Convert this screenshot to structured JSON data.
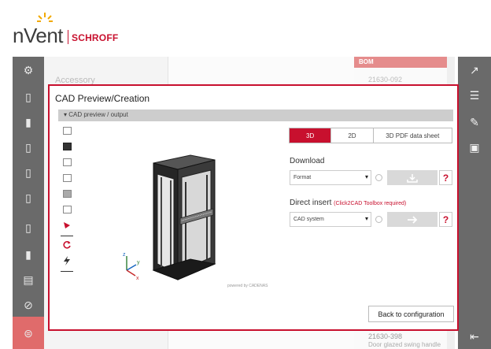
{
  "brand": {
    "name": "nVent",
    "product": "SCHROFF"
  },
  "background": {
    "accessory_label": "Accessory",
    "bom_header": "BOM",
    "bom_part_top": "21630-092",
    "bom_part_bottom": "21630-398",
    "bom_part_bottom_desc": "Door glazed swing handle"
  },
  "modal": {
    "title": "CAD Preview/Creation",
    "section": "▾ CAD preview / output",
    "powered_by": "powered by CADENAS",
    "tabs": [
      {
        "label": "3D",
        "active": true
      },
      {
        "label": "2D",
        "active": false
      },
      {
        "label": "3D PDF data sheet",
        "active": false
      }
    ],
    "download": {
      "heading": "Download",
      "select_value": "Format",
      "help": "?"
    },
    "direct_insert": {
      "heading": "Direct insert",
      "note": "(Click2CAD Toolbox required)",
      "select_value": "CAD system",
      "help": "?"
    },
    "back_button": "Back to configuration"
  },
  "axes": {
    "x": "x",
    "y": "y",
    "z": "z"
  },
  "colors": {
    "accent": "#c8102e",
    "sidebar": "#6a6a6a",
    "bom_header": "#e58c8c"
  }
}
